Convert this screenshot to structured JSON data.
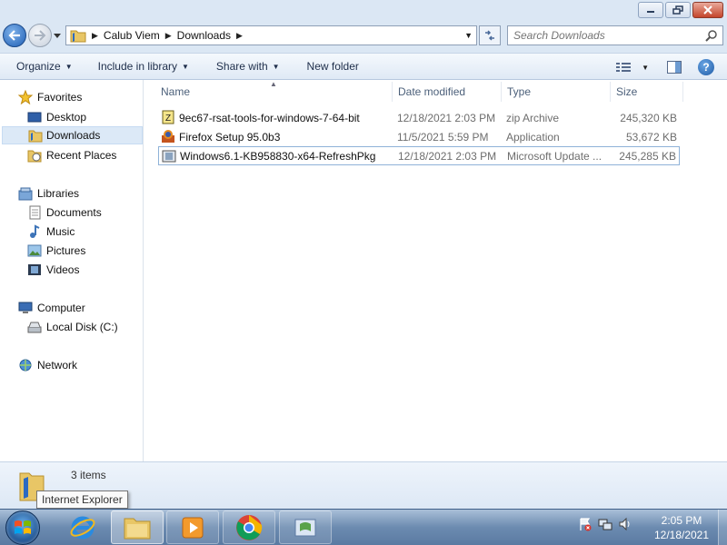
{
  "window": {
    "minimize_label": "Minimize",
    "maximize_label": "Maximize",
    "close_label": "Close"
  },
  "address": {
    "crumbs": [
      "Calub Viem",
      "Downloads"
    ],
    "search_placeholder": "Search Downloads"
  },
  "toolbar": {
    "organize": "Organize",
    "include_in_library": "Include in library",
    "share_with": "Share with",
    "new_folder": "New folder"
  },
  "nav": {
    "favorites": "Favorites",
    "desktop": "Desktop",
    "downloads": "Downloads",
    "recent_places": "Recent Places",
    "libraries": "Libraries",
    "documents": "Documents",
    "music": "Music",
    "pictures": "Pictures",
    "videos": "Videos",
    "computer": "Computer",
    "local_disk": "Local Disk (C:)",
    "network": "Network"
  },
  "columns": {
    "name": "Name",
    "date_modified": "Date modified",
    "type": "Type",
    "size": "Size"
  },
  "files": [
    {
      "name": "9ec67-rsat-tools-for-windows-7-64-bit",
      "date": "12/18/2021 2:03 PM",
      "type": "zip Archive",
      "size": "245,320 KB",
      "icon": "zip-icon"
    },
    {
      "name": "Firefox Setup 95.0b3",
      "date": "11/5/2021 5:59 PM",
      "type": "Application",
      "size": "53,672 KB",
      "icon": "installer-icon"
    },
    {
      "name": "Windows6.1-KB958830-x64-RefreshPkg",
      "date": "12/18/2021 2:03 PM",
      "type": "Microsoft Update ...",
      "size": "245,285 KB",
      "icon": "update-package-icon"
    }
  ],
  "details": {
    "items_count": "3 items",
    "tooltip": "Internet Explorer"
  },
  "taskbar": {
    "time": "2:05 PM",
    "date": "12/18/2021"
  },
  "colors": {
    "accent": "#1f5fb5",
    "selection": "#dce9f7",
    "taskbar": "#6c8bb0"
  }
}
